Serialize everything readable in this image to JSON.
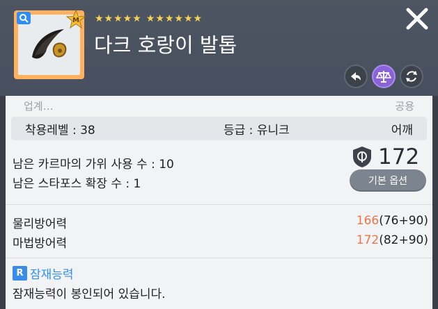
{
  "header": {
    "stars_group1": "★★★★★",
    "stars_group2": "★★★★★★",
    "item_name": "다크 호랑이 발톱",
    "item_badge": "M",
    "accent_color": "#ffb15e"
  },
  "info": {
    "cut_left": "업계…",
    "cut_right": "공용",
    "req_level_label": "착용레벨 :",
    "req_level_value": "38",
    "grade_label": "등급 :",
    "grade_value": "유니크",
    "slot": "어깨"
  },
  "upgrades": {
    "karma_scissors": "남은 카르마의 가위 사용 수 :  10",
    "starforce": "남은 스타포스 확장 수 : 1"
  },
  "score": {
    "value": "172",
    "base_option_button": "기본 옵션"
  },
  "stats": [
    {
      "name": "물리방어력",
      "total": "166",
      "detail": "(76+90)"
    },
    {
      "name": "마법방어력",
      "total": "172",
      "detail": "(82+90)"
    }
  ],
  "potential": {
    "badge": "R",
    "title": "잠재능력",
    "text": "잠재능력이 봉인되어 있습니다."
  }
}
